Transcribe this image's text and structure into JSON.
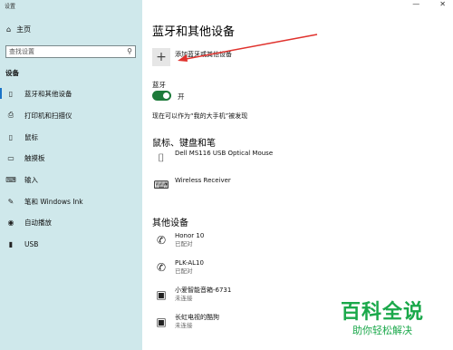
{
  "window": {
    "title": "设置",
    "minimize": "—",
    "close": "✕"
  },
  "sidebar": {
    "home": "主页",
    "search_placeholder": "查找设置",
    "section": "设备",
    "items": [
      {
        "label": "蓝牙和其他设备",
        "icon": "bluetooth-icon"
      },
      {
        "label": "打印机和扫描仪",
        "icon": "printer-icon"
      },
      {
        "label": "鼠标",
        "icon": "mouse-icon"
      },
      {
        "label": "触摸板",
        "icon": "touchpad-icon"
      },
      {
        "label": "输入",
        "icon": "keyboard-icon"
      },
      {
        "label": "笔和 Windows Ink",
        "icon": "pen-icon"
      },
      {
        "label": "自动播放",
        "icon": "autoplay-icon"
      },
      {
        "label": "USB",
        "icon": "usb-icon"
      }
    ]
  },
  "main": {
    "title": "蓝牙和其他设备",
    "add_label": "添加蓝牙或其他设备",
    "bluetooth_label": "蓝牙",
    "toggle_state": "开",
    "discover_text": "现在可以作为“我的大手机”被发现",
    "mouse_section": "鼠标、键盘和笔",
    "mouse_devices": [
      {
        "name": "Dell MS116 USB Optical Mouse",
        "status": "",
        "icon": "mouse-icon"
      },
      {
        "name": "Wireless Receiver",
        "status": "",
        "icon": "keyboard-icon"
      }
    ],
    "other_section": "其他设备",
    "other_devices": [
      {
        "name": "Honor 10",
        "status": "已配对",
        "icon": "phone-icon"
      },
      {
        "name": "PLK-AL10",
        "status": "已配对",
        "icon": "phone-icon"
      },
      {
        "name": "小爱智能音箱-6731",
        "status": "未连接",
        "icon": "display-device-icon"
      },
      {
        "name": "长虹电视的酷狗",
        "status": "未连接",
        "icon": "display-device-icon"
      }
    ]
  },
  "watermark": {
    "line1": "百科全说",
    "line2": "助你轻松解决"
  },
  "colors": {
    "sidebar_bg": "#cfe8eb",
    "toggle_on": "#1d7a3a",
    "accent": "#1a73c8",
    "arrow": "#e0322d",
    "watermark": "#1aa84a"
  }
}
